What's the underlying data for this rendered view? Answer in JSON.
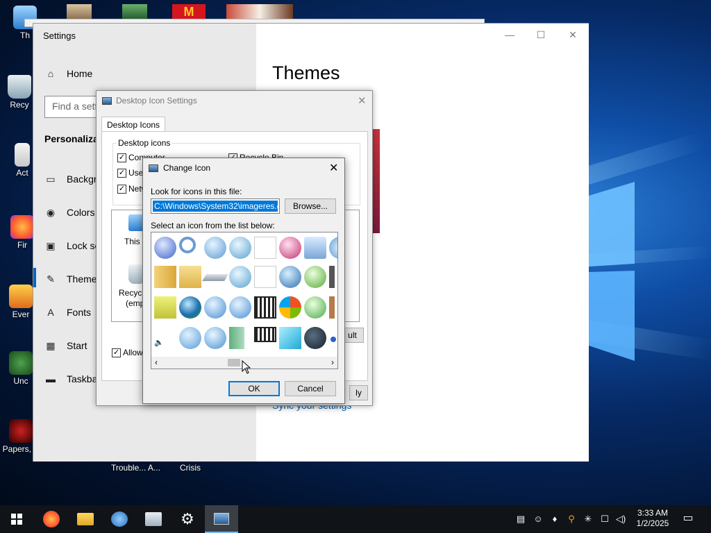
{
  "settings": {
    "window_title": "Settings",
    "home": "Home",
    "search_placeholder": "Find a sett",
    "section": "Personalizat",
    "nav": [
      {
        "icon": "image-icon",
        "label": "Backgr"
      },
      {
        "icon": "palette-icon",
        "label": "Colors"
      },
      {
        "icon": "lock-screen-icon",
        "label": "Lock sc"
      },
      {
        "icon": "themes-icon",
        "label": "Theme"
      },
      {
        "icon": "fonts-icon",
        "label": "Fonts"
      },
      {
        "icon": "start-icon",
        "label": "Start"
      },
      {
        "icon": "taskbar-icon",
        "label": "Taskba"
      }
    ],
    "page_title": "Themes",
    "sync_link": "Sync your settings"
  },
  "desktop_icon_settings": {
    "title": "Desktop Icon Settings",
    "tab": "Desktop Icons",
    "group_label": "Desktop icons",
    "checkboxes": [
      {
        "label": "Computer",
        "checked": true
      },
      {
        "label": "User",
        "checked": true
      },
      {
        "label": "Netw",
        "checked": true
      },
      {
        "label": "Recycle Bin",
        "checked": true
      }
    ],
    "icon_labels": [
      "This P",
      "Recycle",
      "(empt"
    ],
    "default_btn": "ult",
    "allow_label": "Allow t",
    "apply_btn": "ly"
  },
  "change_icon": {
    "title": "Change Icon",
    "look_label": "Look for icons in this file:",
    "file_path": "C:\\Windows\\System32\\imageres.dll",
    "browse": "Browse...",
    "list_label": "Select an icon from the list below:",
    "ok": "OK",
    "cancel": "Cancel"
  },
  "desktop": {
    "labels": [
      "Th",
      "Recy",
      "Act",
      "Fir",
      "Ever",
      "Unc",
      "Papers, P",
      "Trouble... A...",
      "Crisis"
    ]
  },
  "taskbar": {
    "time": "3:33 AM",
    "date": "1/2/2025"
  }
}
